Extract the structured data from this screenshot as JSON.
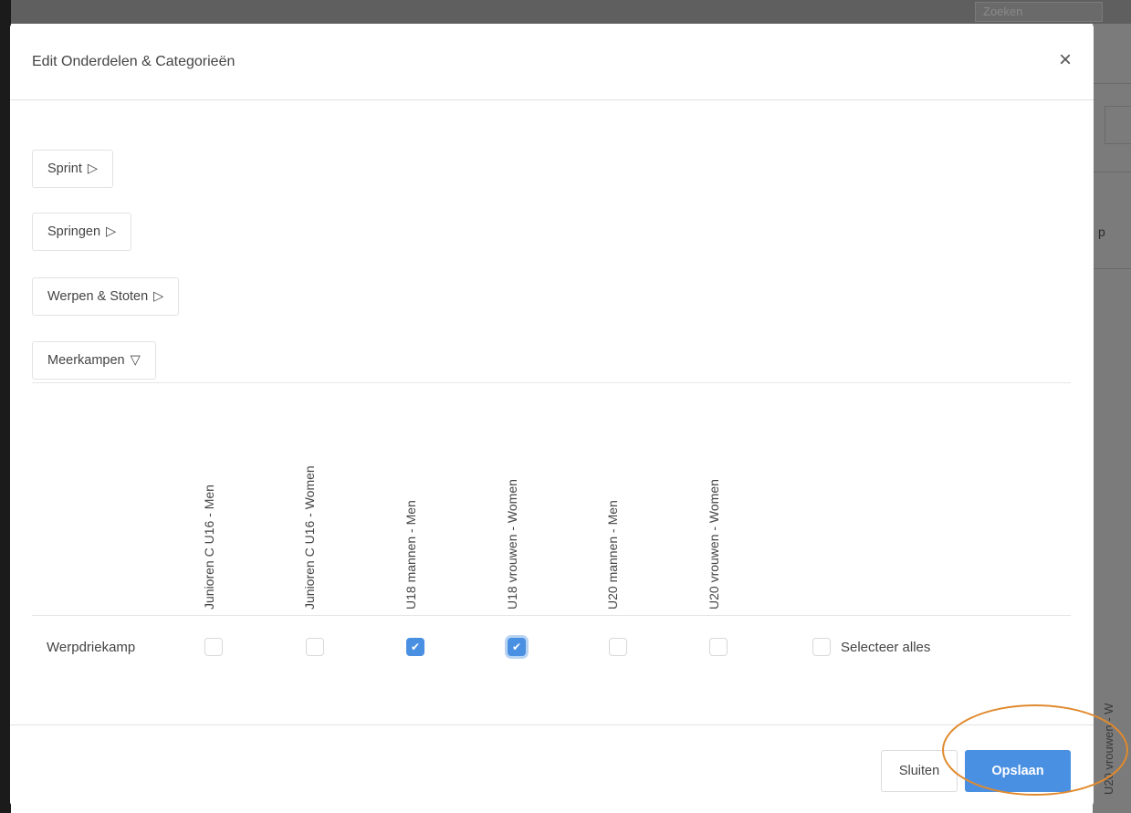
{
  "background": {
    "search_placeholder": "Zoeken",
    "right_partial_text": "p",
    "right_vertical_text": "U20 vrouwen - W"
  },
  "modal": {
    "title": "Edit Onderdelen & Categorieën",
    "close_symbol": "×"
  },
  "groups": [
    {
      "label": "Sprint",
      "expanded": false
    },
    {
      "label": "Springen",
      "expanded": false
    },
    {
      "label": "Werpen & Stoten",
      "expanded": false
    },
    {
      "label": "Meerkampen",
      "expanded": true
    }
  ],
  "icons": {
    "collapsed": "▷",
    "expanded": "▽",
    "check": "✔"
  },
  "columns": [
    "Junioren C U16 - Men",
    "Junioren C U16 - Women",
    "U18 mannen - Men",
    "U18 vrouwen - Women",
    "U20 mannen - Men",
    "U20 vrouwen - Women"
  ],
  "rows": [
    {
      "label": "Werpdriekamp",
      "checked": [
        false,
        false,
        true,
        true,
        false,
        false
      ],
      "select_all": false
    }
  ],
  "select_all_label": "Selecteer alles",
  "footer": {
    "close_label": "Sluiten",
    "save_label": "Opslaan"
  },
  "colors": {
    "accent": "#4a90e2",
    "highlight_ring": "#e08a2e"
  }
}
